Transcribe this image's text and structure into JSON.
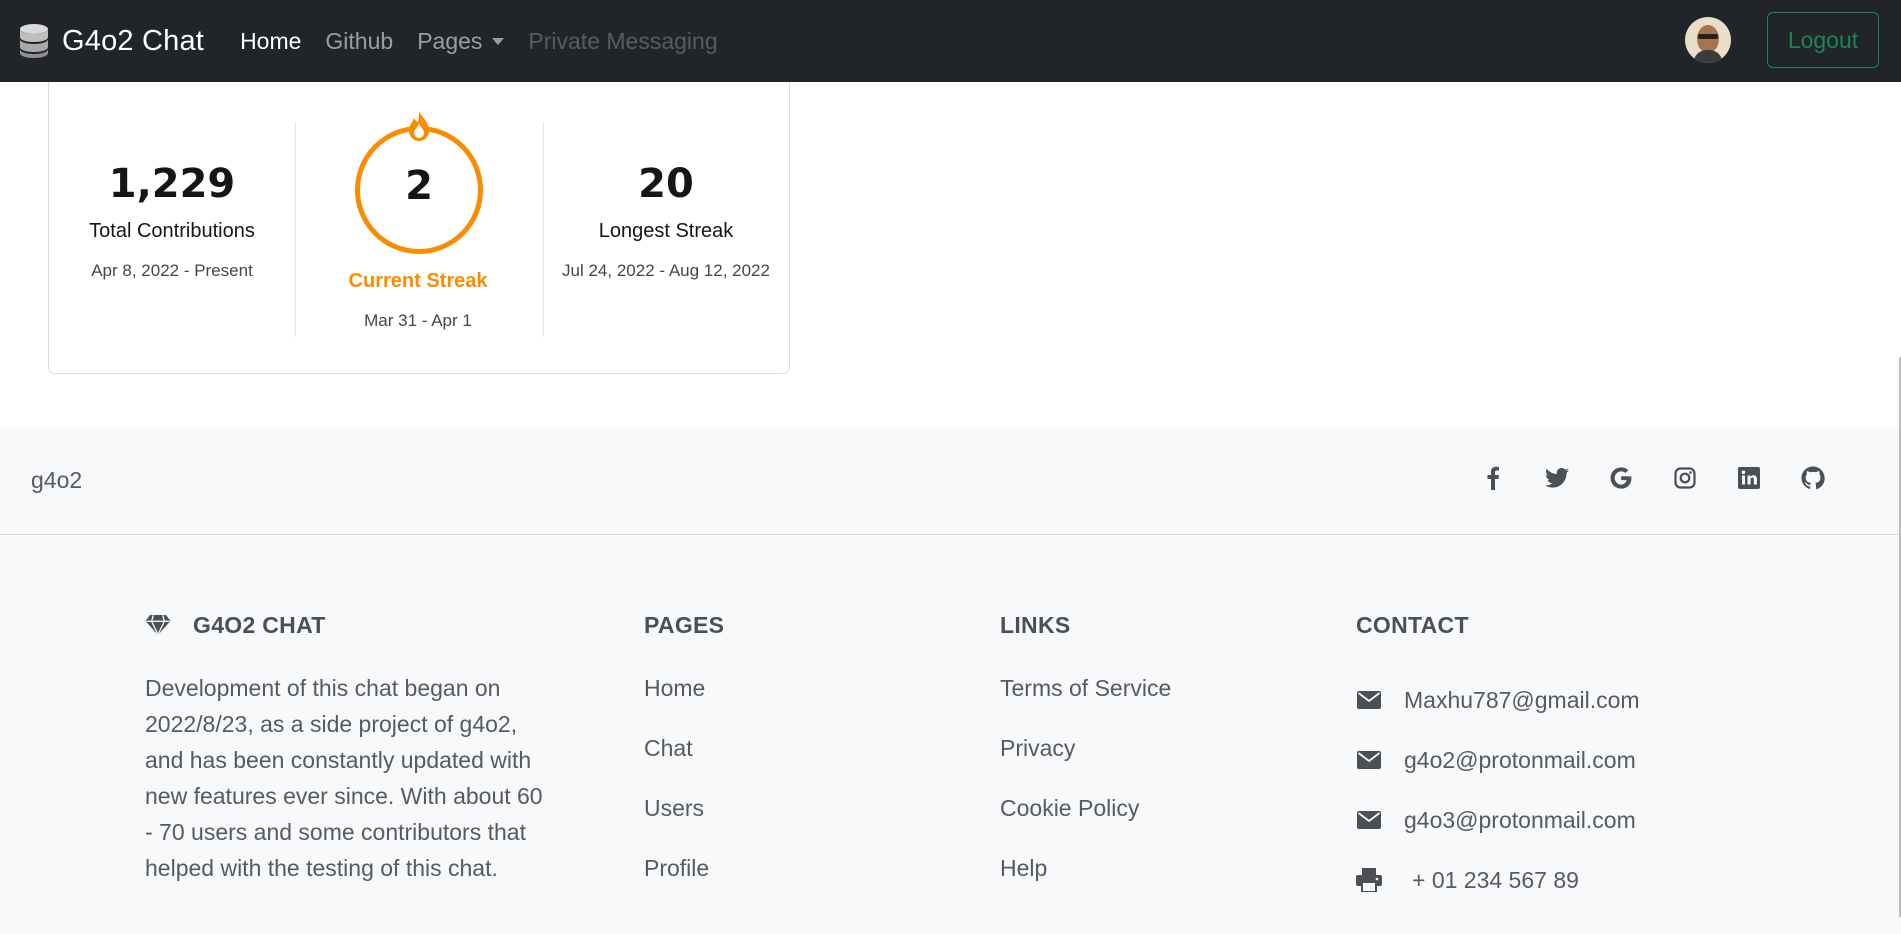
{
  "navbar": {
    "brand": "G4o2 Chat",
    "links": [
      {
        "label": "Home"
      },
      {
        "label": "Github"
      },
      {
        "label": "Pages"
      },
      {
        "label": "Private Messaging"
      }
    ],
    "logout_label": "Logout"
  },
  "streak": {
    "total": {
      "value": "1,229",
      "label": "Total Contributions",
      "range": "Apr 8, 2022 - Present"
    },
    "current": {
      "value": "2",
      "label": "Current Streak",
      "range": "Mar 31 - Apr 1"
    },
    "longest": {
      "value": "20",
      "label": "Longest Streak",
      "range": "Jul 24, 2022 - Aug 12, 2022"
    },
    "accent_color": "#fb8c00"
  },
  "footer": {
    "owner": "g4o2",
    "socials": [
      "facebook-icon",
      "twitter-icon",
      "google-icon",
      "instagram-icon",
      "linkedin-icon",
      "github-icon"
    ],
    "about": {
      "title": "G4O2 CHAT",
      "text": "Development of this chat began on 2022/8/23, as a side project of g4o2, and has been constantly updated with new features ever since. With about 60 - 70 users and some contributors that helped with the testing of this chat."
    },
    "pages": {
      "title": "PAGES",
      "items": [
        "Home",
        "Chat",
        "Users",
        "Profile"
      ]
    },
    "links": {
      "title": "LINKS",
      "items": [
        "Terms of Service",
        "Privacy",
        "Cookie Policy",
        "Help"
      ]
    },
    "contact": {
      "title": "CONTACT",
      "items": [
        {
          "icon": "envelope-icon",
          "text": "Maxhu787@gmail.com"
        },
        {
          "icon": "envelope-icon",
          "text": "g4o2@protonmail.com"
        },
        {
          "icon": "envelope-icon",
          "text": "g4o3@protonmail.com"
        },
        {
          "icon": "printer-icon",
          "text": "+ 01 234 567 89"
        }
      ]
    }
  }
}
